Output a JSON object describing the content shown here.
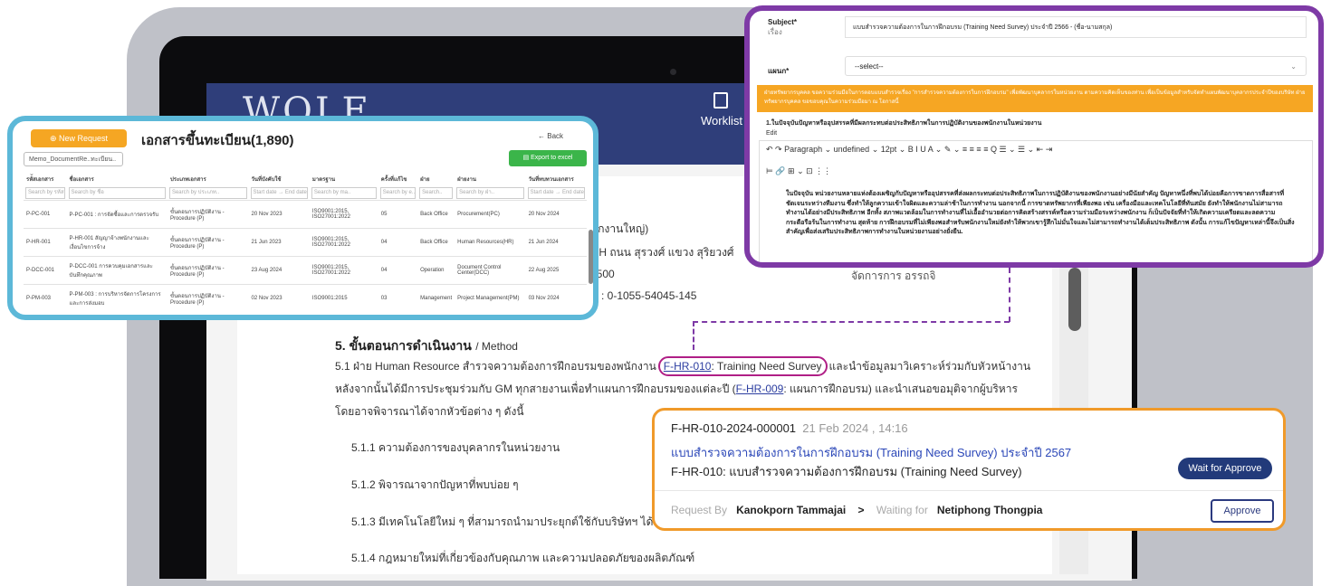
{
  "app": {
    "logo": "WOLF",
    "worklist_label": "Worklist"
  },
  "doc": {
    "line_r1": "นักงานใหญ่)",
    "line_r2": "GH ถนน สุรวงศ์ แขวง สุริยวงศ์",
    "line_r3": "0500",
    "line_r4": "D : 0-1055-54045-145",
    "section_title": "5. ขั้นตอนการดำเนินงาน",
    "section_title_en": "/ Method",
    "p1_a": "5.1 ฝ่าย Human Resource สำรวจความต้องการฝึกอบรมของพนักงาน",
    "p1_link": "F-HR-010",
    "p1_b": ": Training Need Survey",
    "p1_c": "และนำข้อมูลมาวิเคราะห์ร่วมกับหัวหน้างาน",
    "p2_a": "หลังจากนั้นได้มีการประชุมร่วมกับ GM ทุกสายงานเพื่อทำแผนการฝึกอบรมของแต่ละปี (",
    "p2_link": "F-HR-009",
    "p2_b": ": แผนการฝึกอบรม)  และนำเสนอขอมุติจากผู้บริหาร",
    "p3": "โดยอาจพิจารณาได้จากหัวข้อต่าง ๆ ดังนี้",
    "items": [
      "5.1.1 ความต้องการของบุคลากรในหน่วยงาน",
      "5.1.2 พิจารณาจากปัญหาที่พบบ่อย ๆ",
      "5.1.3 มีเทคโนโลยีใหม่ ๆ ที่สามารถนำมาประยุกต์ใช้กับบริษัทฯ ได้",
      "5.1.4 กฎหมายใหม่ที่เกี่ยวข้องกับคุณภาพ และความปลอดภัยของผลิตภัณฑ์"
    ],
    "ghost": "จัดการการ อรรถจิ"
  },
  "list_card": {
    "new_request": "New Request",
    "title": "เอกสารขึ้นทะเบียน(1,890)",
    "back": "Back",
    "select_value": "Memo_DocumentRe..ทะเบียน..",
    "export": "Export to excel",
    "headers": [
      "รหัสเอกสาร",
      "ชื่อเอกสาร",
      "ประเภทเอกสาร",
      "วันที่บังคับใช้",
      "มาตรฐาน",
      "ครั้งที่แก้ไข",
      "ฝ่าย",
      "ฝ่ายงาน",
      "วันที่ทบทวนเอกสาร"
    ],
    "filters": [
      "Search by รหัส",
      "Search by ชื่อ",
      "Search by ประเภท..",
      "Start date  →  End date",
      "Search by ma..",
      "Search by e..",
      "Search..",
      "Search by ฝ่า..",
      "Start date  →  End date"
    ],
    "rows": [
      [
        "P-PC-001",
        "P-PC-001 : การจัดซื้อและการตรวจรับ",
        "ขั้นตอนการปฏิบัติงาน - Procedure (P)",
        "20 Nov 2023",
        "ISO9001:2015, ISO27001:2022",
        "05",
        "Back Office",
        "Procurement(PC)",
        "20 Nov 2024"
      ],
      [
        "P-HR-001",
        "P-HR-001 สัญญาจ้างพนักงานและเงื่อนไขการจ้าง",
        "ขั้นตอนการปฏิบัติงาน - Procedure (P)",
        "21 Jun 2023",
        "ISO9001:2015, ISO27001:2022",
        "04",
        "Back Office",
        "Human Resources(HR)",
        "21 Jun 2024"
      ],
      [
        "P-DCC-001",
        "P-DCC-001 การควบคุมเอกสารและบันทึกคุณภาพ",
        "ขั้นตอนการปฏิบัติงาน - Procedure (P)",
        "23 Aug 2024",
        "ISO9001:2015, ISO27001:2022",
        "04",
        "Operation",
        "Document Control Center(DCC)",
        "22 Aug 2025"
      ],
      [
        "P-PM-003",
        "P-PM-003 : การบริหารจัดการโครงการและการส่งมอบ",
        "ขั้นตอนการปฏิบัติงาน - Procedure (P)",
        "02 Nov 2023",
        "ISO9001:2015",
        "03",
        "Management",
        "Project Management(PM)",
        "03 Nov 2024"
      ]
    ]
  },
  "form_card": {
    "subject_label": "Subject*",
    "subject_sub": "เรื่อง",
    "subject_value": "แบบสำรวจความต้องการในการฝึกอบรม (Training Need Survey) ประจำปี 2566 - (ชื่อ-นามสกุล)",
    "dept_label": "แผนก*",
    "dept_value": "--select--",
    "banner": "ฝ่ายทรัพยากรบุคคล ขอความร่วมมือในการตอบแบบสำรวจเรื่อง \"การสำรวจความต้องการในการฝึกอบรม\" เพื่อพัฒนาบุคลากรในหน่วยงาน ตามความคิดเห็นของท่าน เพื่อเป็นข้อมูลสำหรับจัดทำแผนพัฒนาบุคลากรประจำปีของบริษัท ฝ่ายทรัพยากรบุคคล ขอขอบคุณในความร่วมมือมา ณ โอกาสนี้",
    "question": "1.ในปัจจุบันปัญหาหรืออุปสรรคที่มีผลกระทบต่อประสิทธิภาพในการปฏิบัติงานของพนักงานในหน่วยงาน",
    "edit": "Edit",
    "toolbar_1": "↶   ↷     Paragraph   ⌄   undefined   ⌄   12pt            ⌄     B   I   U    A ⌄   ✎ ⌄    ≡   ≡   ≡   ≡    Q    ☰ ⌄  ☰ ⌄   ⇤   ⇥",
    "toolbar_2": "⊨    🔗   ⊞ ⌄    ⊡    ⋮⋮",
    "body": "ในปัจจุบัน หน่วยงานหลายแห่งต้องเผชิญกับปัญหาหรืออุปสรรคที่ส่งผลกระทบต่อประสิทธิภาพในการปฏิบัติงานของพนักงานอย่างมีนัยสำคัญ ปัญหาหนึ่งที่พบได้บ่อยคือการขาดการสื่อสารที่ชัดเจนระหว่างทีมงาน ซึ่งทำให้ลูกความเข้าใจผิดและความล่าช้าในการทำงาน นอกจากนี้ การขาดทรัพยากรที่เพียงพอ เช่น เครื่องมือและเทคโนโลยีที่ทันสมัย ยังทำให้พนักงานไม่สามารถทำงานได้อย่างมีประสิทธิภาพ อีกทั้ง สภาพแวดล้อมในการทำงานที่ไม่เอื้ออำนวยต่อการคิดสร้างสรรค์หรือความร่วมมือระหว่างพนักงาน ก็เป็นปัจจัยที่ทำให้เกิดความเครียดและลดความกระตือรือร้นในการทำงาน สุดท้าย การฝึกอบรมที่ไม่เพียงพอสำหรับพนักงานใหม่ยังทำให้พวกเขารู้สึกไม่มั่นใจและไม่สามารถทำงานได้เต็มประสิทธิภาพ ดังนั้น การแก้ไขปัญหาเหล่านี้จึงเป็นสิ่งสำคัญเพื่อส่งเสริมประสิทธิภาพการทำงานในหน่วยงานอย่างยั่งยืน."
  },
  "approval_card": {
    "doc_id": "F-HR-010-2024-000001",
    "datetime": "21 Feb 2024 , 14:16",
    "title": "แบบสำรวจความต้องการในการฝึกอบรม (Training Need Survey) ประจำปี 2567",
    "form_name": "F-HR-010: แบบสำรวจความต้องการฝึกอบรม (Training Need Survey)",
    "status": "Wait for Approve",
    "request_by_label": "Request By",
    "requester": "Kanokporn Tammajai",
    "arrow": ">",
    "waiting_label": "Waiting for",
    "approver": "Netiphong Thongpia",
    "approve_button": "Approve"
  },
  "colors": {
    "primary": "#2f3e7a",
    "orange": "#f5a623",
    "purple": "#7e3aa6",
    "teal": "#5cb8d8",
    "green": "#3bb54a",
    "navy": "#223a7a"
  }
}
